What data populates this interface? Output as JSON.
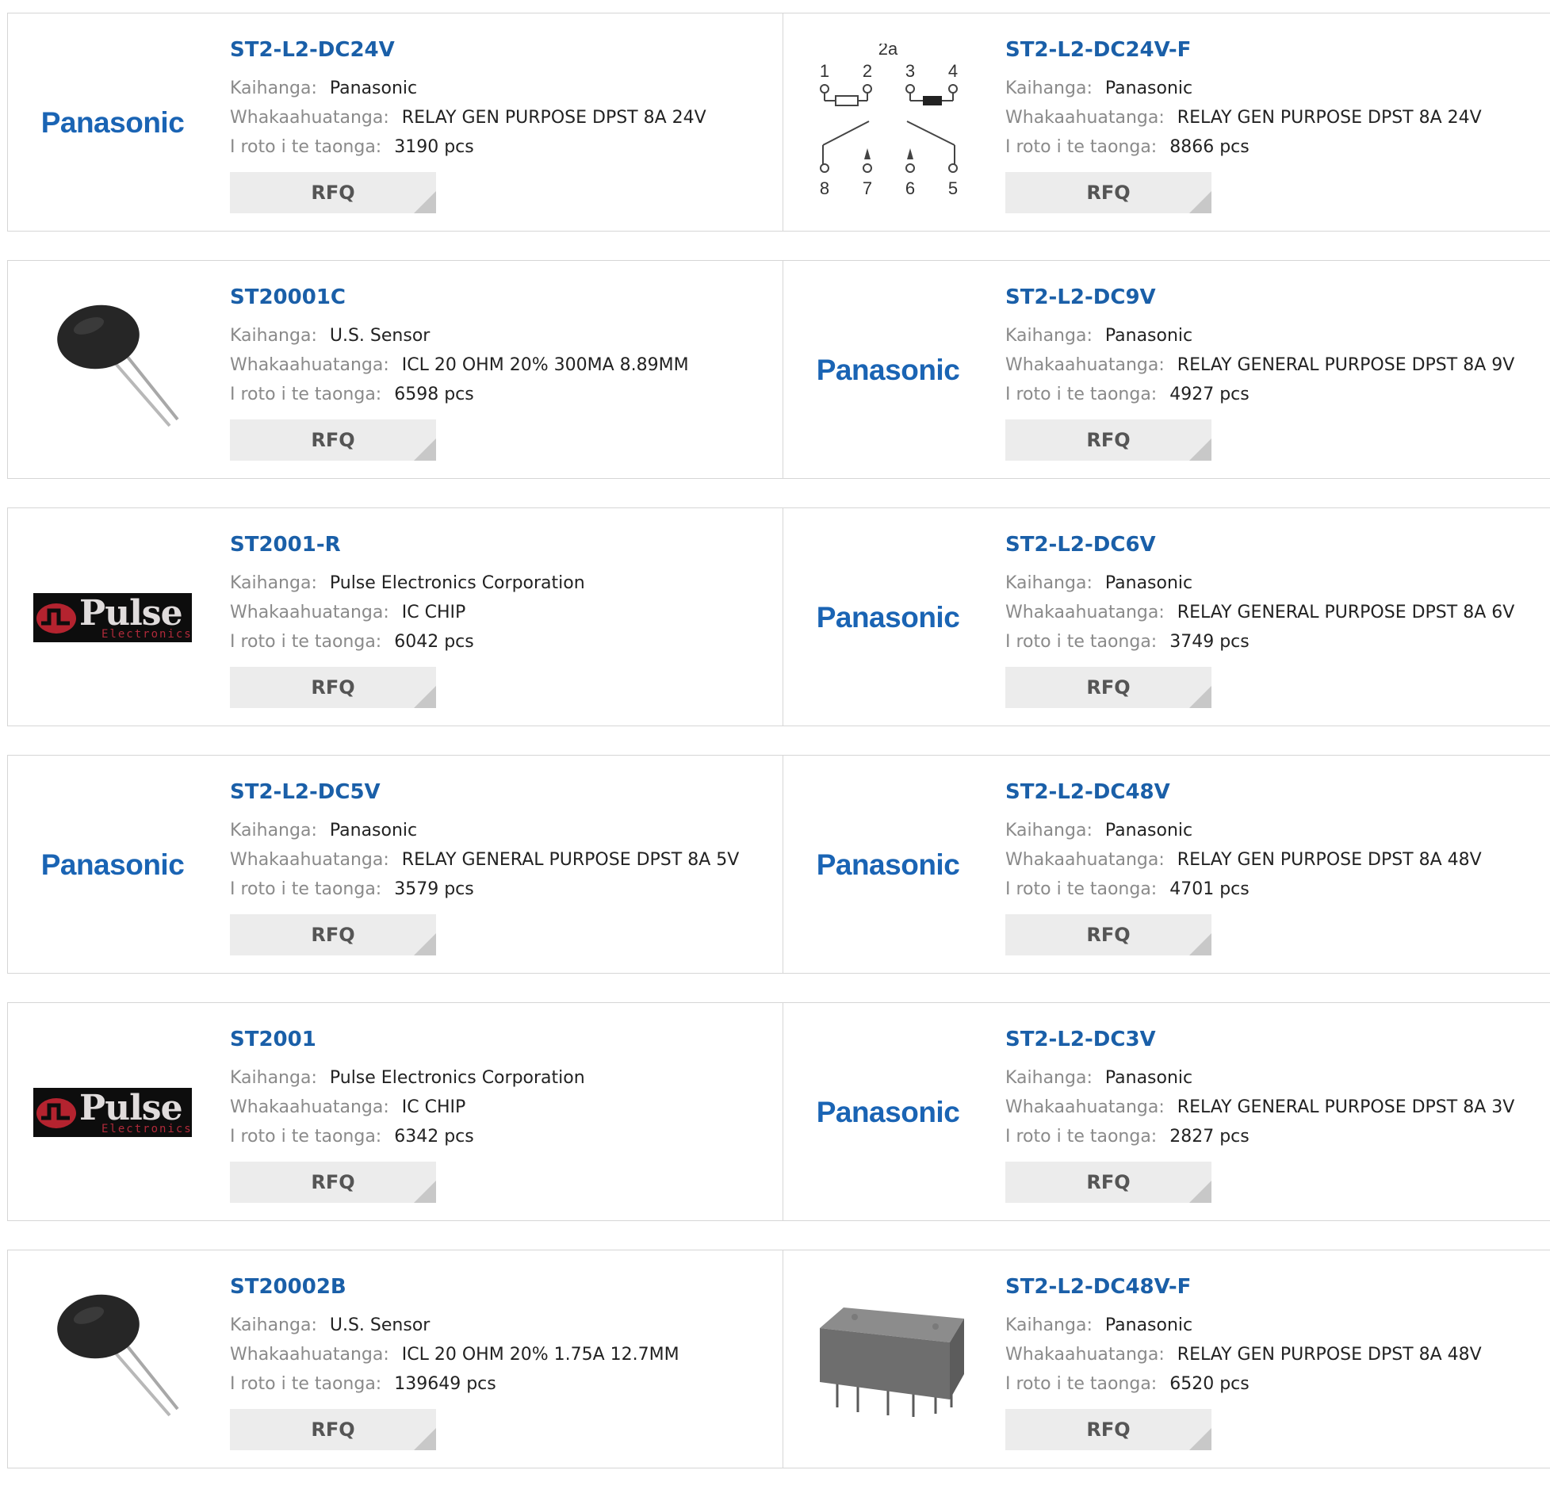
{
  "labels": {
    "manufacturer": "Kaihanga:",
    "description": "Whakaahuatanga:",
    "stock": "I roto i te taonga:",
    "rfq": "RFQ"
  },
  "logos": {
    "panasonic": "Panasonic",
    "pulse": "Pulse",
    "pulse_sub": "Electronics"
  },
  "diagram": {
    "title": "2a",
    "pins_top": [
      "1",
      "2",
      "3",
      "4"
    ],
    "pins_bottom": [
      "8",
      "7",
      "6",
      "5"
    ]
  },
  "products": [
    {
      "pn": "ST2-L2-DC24V",
      "manufacturer": "Panasonic",
      "description": "RELAY GEN PURPOSE DPST 8A 24V",
      "stock": "3190 pcs",
      "image": "panasonic-logo"
    },
    {
      "pn": "ST2-L2-DC24V-F",
      "manufacturer": "Panasonic",
      "description": "RELAY GEN PURPOSE DPST 8A 24V",
      "stock": "8866 pcs",
      "image": "relay-diagram"
    },
    {
      "pn": "ST20001C",
      "manufacturer": "U.S. Sensor",
      "description": "ICL 20 OHM 20% 300MA 8.89MM",
      "stock": "6598 pcs",
      "image": "thermistor-photo"
    },
    {
      "pn": "ST2-L2-DC9V",
      "manufacturer": "Panasonic",
      "description": "RELAY GENERAL PURPOSE DPST 8A 9V",
      "stock": "4927 pcs",
      "image": "panasonic-logo"
    },
    {
      "pn": "ST2001-R",
      "manufacturer": "Pulse Electronics Corporation",
      "description": "IC CHIP",
      "stock": "6042 pcs",
      "image": "pulse-logo"
    },
    {
      "pn": "ST2-L2-DC6V",
      "manufacturer": "Panasonic",
      "description": "RELAY GENERAL PURPOSE DPST 8A 6V",
      "stock": "3749 pcs",
      "image": "panasonic-logo"
    },
    {
      "pn": "ST2-L2-DC5V",
      "manufacturer": "Panasonic",
      "description": "RELAY GENERAL PURPOSE DPST 8A 5V",
      "stock": "3579 pcs",
      "image": "panasonic-logo"
    },
    {
      "pn": "ST2-L2-DC48V",
      "manufacturer": "Panasonic",
      "description": "RELAY GEN PURPOSE DPST 8A 48V",
      "stock": "4701 pcs",
      "image": "panasonic-logo"
    },
    {
      "pn": "ST2001",
      "manufacturer": "Pulse Electronics Corporation",
      "description": "IC CHIP",
      "stock": "6342 pcs",
      "image": "pulse-logo"
    },
    {
      "pn": "ST2-L2-DC3V",
      "manufacturer": "Panasonic",
      "description": "RELAY GENERAL PURPOSE DPST 8A 3V",
      "stock": "2827 pcs",
      "image": "panasonic-logo"
    },
    {
      "pn": "ST20002B",
      "manufacturer": "U.S. Sensor",
      "description": "ICL 20 OHM 20% 1.75A 12.7MM",
      "stock": "139649 pcs",
      "image": "thermistor-photo"
    },
    {
      "pn": "ST2-L2-DC48V-F",
      "manufacturer": "Panasonic",
      "description": "RELAY GEN PURPOSE DPST 8A 48V",
      "stock": "6520 pcs",
      "image": "relay-photo"
    }
  ],
  "colors": {
    "part_number": "#1a5fa8",
    "label": "#8a8a8a",
    "value": "#222222",
    "rfq_bg": "#ececec",
    "border": "#d6d6d6"
  }
}
